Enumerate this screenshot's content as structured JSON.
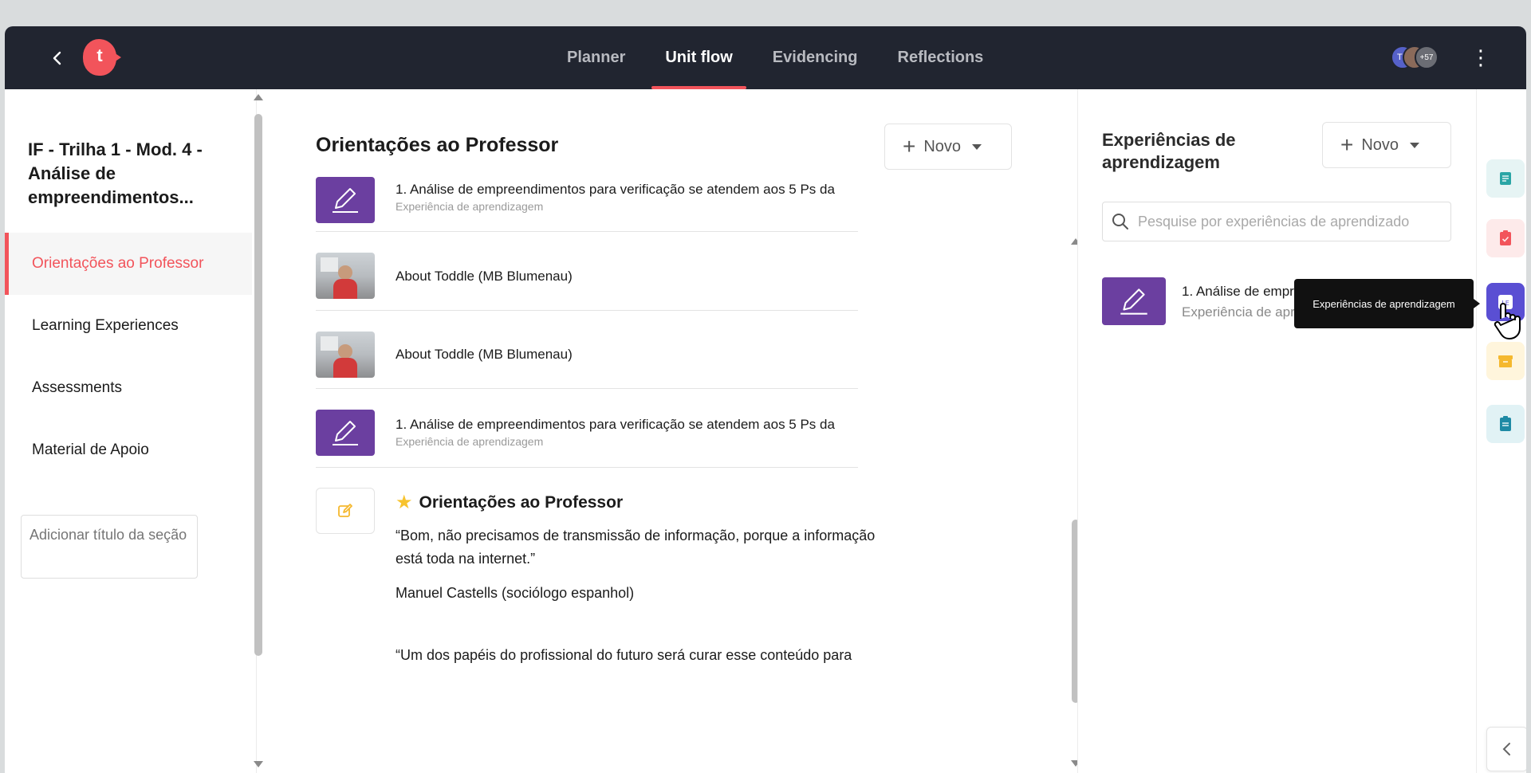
{
  "topbar": {
    "logo_letter": "t",
    "tabs": [
      {
        "label": "Planner",
        "active": false
      },
      {
        "label": "Unit flow",
        "active": true
      },
      {
        "label": "Evidencing",
        "active": false
      },
      {
        "label": "Reflections",
        "active": false
      }
    ],
    "avatars": [
      "TS",
      "",
      "+57"
    ]
  },
  "sidebar": {
    "unit_title": "IF - Trilha 1 - Mod. 4 - Análise de empreendimentos...",
    "items": [
      {
        "label": "Orientações ao Professor",
        "active": true
      },
      {
        "label": "Learning Experiences",
        "active": false
      },
      {
        "label": "Assessments",
        "active": false
      },
      {
        "label": "Material de Apoio",
        "active": false
      }
    ],
    "section_placeholder": "Adicionar título da seção"
  },
  "main": {
    "title": "Orientações ao Professor",
    "new_label": "Novo",
    "items": [
      {
        "title": "1. Análise de empreendimentos para verificação se atendem aos 5 Ps da",
        "subtitle": "Experiência de aprendizagem",
        "kind": "le"
      },
      {
        "title": "About Toddle (MB Blumenau)",
        "subtitle": "",
        "kind": "video"
      },
      {
        "title": "About Toddle (MB Blumenau)",
        "subtitle": "",
        "kind": "video"
      },
      {
        "title": "1. Análise de empreendimentos para verificação se atendem aos 5 Ps da",
        "subtitle": "Experiência de aprendizagem",
        "kind": "le"
      }
    ],
    "note": {
      "heading": "Orientações ao Professor",
      "quote1_line1": "“Bom, não precisamos de transmissão de informação, porque a informação",
      "quote1_line2": "está toda na internet.”",
      "author": "Manuel Castells (sociólogo espanhol)",
      "quote2_line1": "“Um dos papéis do profissional do futuro será curar esse conteúdo para"
    }
  },
  "rpanel": {
    "title": "Experiências de aprendizagem",
    "new_label": "Novo",
    "search_placeholder": "Pesquise por experiências de aprendizado",
    "item": {
      "title": "1. Análise de empreendimento...",
      "subtitle": "Experiência de aprendizagem"
    },
    "tooltip": "Experiências de aprendizagem"
  },
  "rail": {
    "le_badge": "LE",
    "colors": {
      "teal": "#2aa5a5",
      "red": "#f2545b",
      "indigo": "#5a4fd3",
      "amber": "#f5b82e",
      "cyan": "#1e8aa5"
    }
  }
}
